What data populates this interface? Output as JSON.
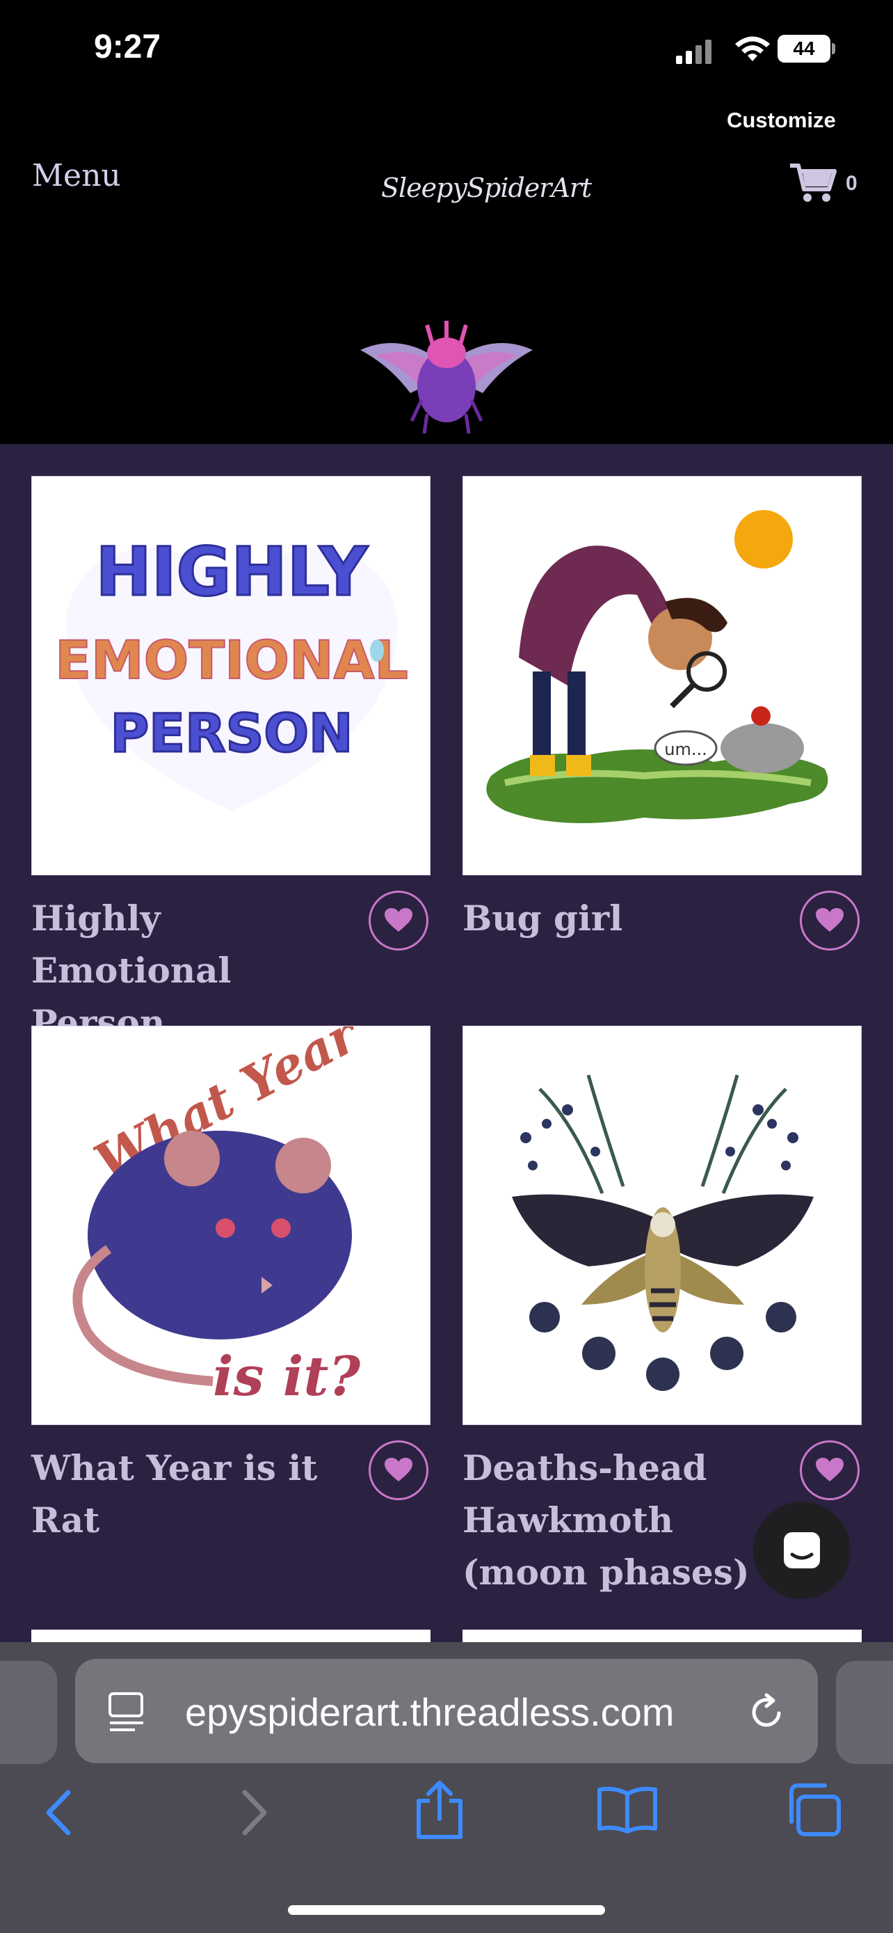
{
  "status_bar": {
    "time": "9:27",
    "battery": "44"
  },
  "header": {
    "customize_label": "Customize",
    "menu_label": "Menu",
    "logo_text": "SleepySpiderArt",
    "cart_count": "0"
  },
  "products": [
    {
      "title": "Highly Emotional Person",
      "art": "HIGHLY EMOTIONAL PERSON"
    },
    {
      "title": "Bug girl",
      "art": "um..."
    },
    {
      "title": "What Year is it Rat",
      "art": "What Year is it?"
    },
    {
      "title": "Deaths-head Hawkmoth (moon phases)",
      "art": ""
    }
  ],
  "browser": {
    "url": "epyspiderart.threadless.com"
  },
  "colors": {
    "page_bg": "#2b2141",
    "header_bg": "#000000",
    "heart": "#c978c9",
    "accent_blue": "#3d8bff"
  }
}
